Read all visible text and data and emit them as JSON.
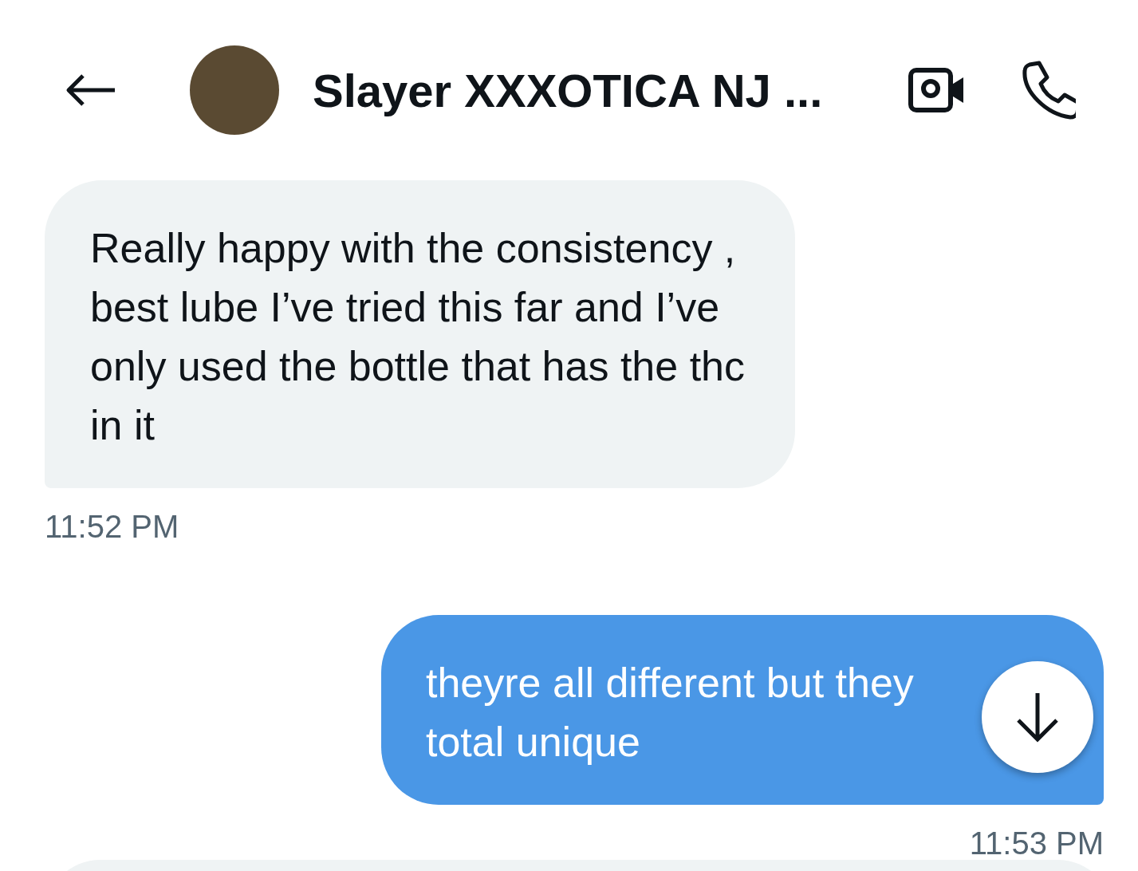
{
  "header": {
    "title": "Slayer XXXOTICA NJ ..."
  },
  "messages": [
    {
      "kind": "received",
      "text": "Really happy with the consistency , best lube I’ve tried this far and I’ve only used the bottle that has the thc in it",
      "time": "11:52 PM"
    },
    {
      "kind": "sent",
      "text": "theyre all different but they total unique",
      "time": "11:53 PM"
    }
  ]
}
